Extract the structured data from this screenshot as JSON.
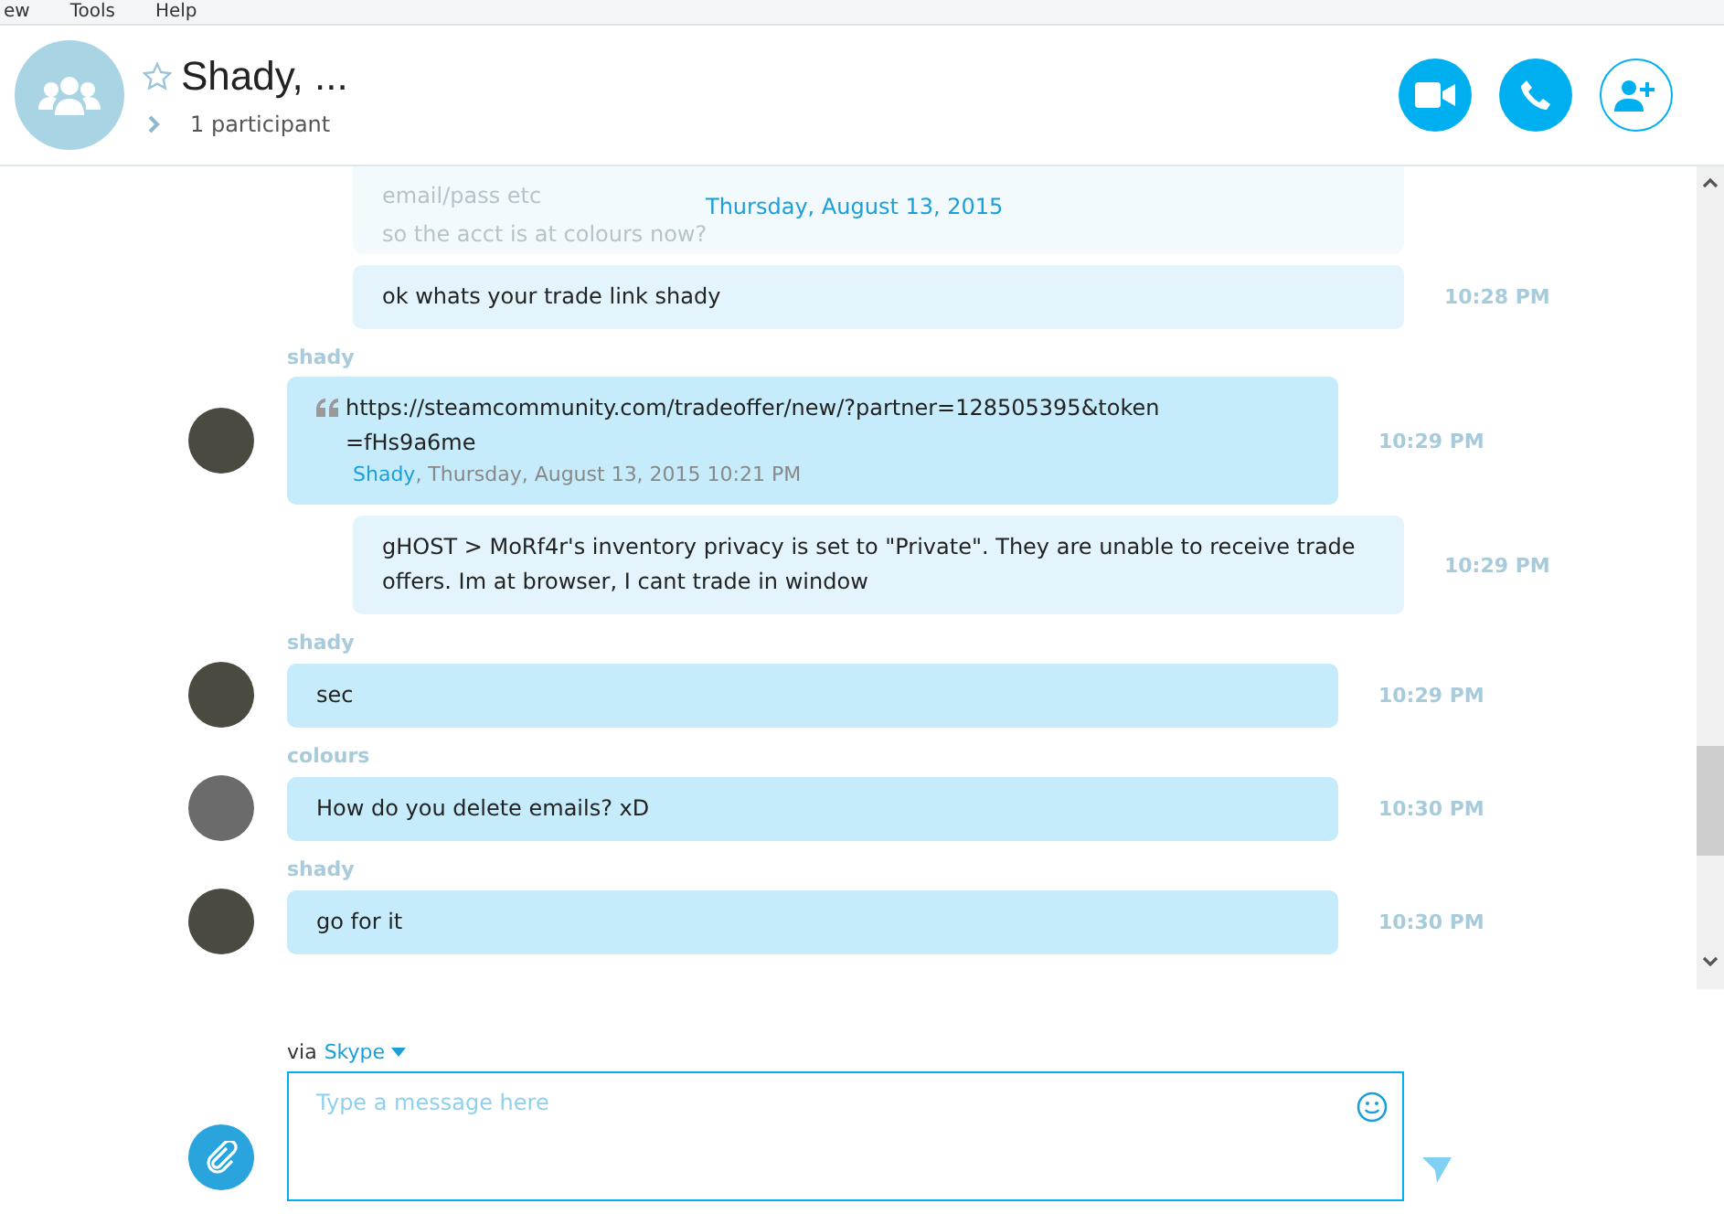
{
  "menu": [
    "ew",
    "Tools",
    "Help"
  ],
  "conversation": {
    "title": "Shady, ...",
    "favorite": false,
    "participants": "1 participant"
  },
  "date_header": "Thursday, August 13, 2015",
  "faded_messages": [
    "email/pass etc",
    "so the acct is at colours now?"
  ],
  "messages": [
    {
      "kind": "outgoing",
      "text": "ok whats your trade link shady",
      "time": "10:28 PM"
    },
    {
      "kind": "quote",
      "sender": "shady",
      "text": "https://steamcommunity.com/tradeoffer/new/?partner=128505395&token =fHs9a6me",
      "quote_author": "Shady",
      "quote_meta": ", Thursday, August 13, 2015 10:21 PM",
      "time": "10:29 PM"
    },
    {
      "kind": "outgoing",
      "text": "gHOST > MoRf4r's inventory privacy is set to \"Private\". They are unable to receive trade offers. Im at browser, I cant trade in window",
      "time": "10:29 PM"
    },
    {
      "kind": "incoming",
      "sender": "shady",
      "text": "sec",
      "time": "10:29 PM"
    },
    {
      "kind": "incoming",
      "sender": "colours",
      "text": "How do you delete emails? xD",
      "time": "10:30 PM"
    },
    {
      "kind": "incoming",
      "sender": "shady",
      "text": "go for it",
      "time": "10:30 PM"
    }
  ],
  "compose": {
    "via": "via",
    "service": "Skype",
    "placeholder": "Type a message here"
  }
}
